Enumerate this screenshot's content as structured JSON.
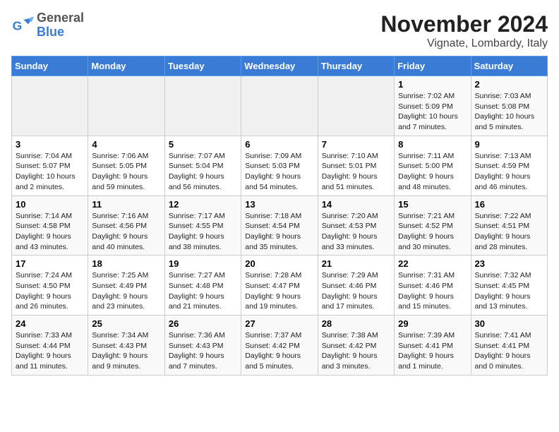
{
  "header": {
    "title": "November 2024",
    "subtitle": "Vignate, Lombardy, Italy",
    "logo_line1": "General",
    "logo_line2": "Blue"
  },
  "weekdays": [
    "Sunday",
    "Monday",
    "Tuesday",
    "Wednesday",
    "Thursday",
    "Friday",
    "Saturday"
  ],
  "weeks": [
    [
      {
        "day": "",
        "info": ""
      },
      {
        "day": "",
        "info": ""
      },
      {
        "day": "",
        "info": ""
      },
      {
        "day": "",
        "info": ""
      },
      {
        "day": "",
        "info": ""
      },
      {
        "day": "1",
        "info": "Sunrise: 7:02 AM\nSunset: 5:09 PM\nDaylight: 10 hours and 7 minutes."
      },
      {
        "day": "2",
        "info": "Sunrise: 7:03 AM\nSunset: 5:08 PM\nDaylight: 10 hours and 5 minutes."
      }
    ],
    [
      {
        "day": "3",
        "info": "Sunrise: 7:04 AM\nSunset: 5:07 PM\nDaylight: 10 hours and 2 minutes."
      },
      {
        "day": "4",
        "info": "Sunrise: 7:06 AM\nSunset: 5:05 PM\nDaylight: 9 hours and 59 minutes."
      },
      {
        "day": "5",
        "info": "Sunrise: 7:07 AM\nSunset: 5:04 PM\nDaylight: 9 hours and 56 minutes."
      },
      {
        "day": "6",
        "info": "Sunrise: 7:09 AM\nSunset: 5:03 PM\nDaylight: 9 hours and 54 minutes."
      },
      {
        "day": "7",
        "info": "Sunrise: 7:10 AM\nSunset: 5:01 PM\nDaylight: 9 hours and 51 minutes."
      },
      {
        "day": "8",
        "info": "Sunrise: 7:11 AM\nSunset: 5:00 PM\nDaylight: 9 hours and 48 minutes."
      },
      {
        "day": "9",
        "info": "Sunrise: 7:13 AM\nSunset: 4:59 PM\nDaylight: 9 hours and 46 minutes."
      }
    ],
    [
      {
        "day": "10",
        "info": "Sunrise: 7:14 AM\nSunset: 4:58 PM\nDaylight: 9 hours and 43 minutes."
      },
      {
        "day": "11",
        "info": "Sunrise: 7:16 AM\nSunset: 4:56 PM\nDaylight: 9 hours and 40 minutes."
      },
      {
        "day": "12",
        "info": "Sunrise: 7:17 AM\nSunset: 4:55 PM\nDaylight: 9 hours and 38 minutes."
      },
      {
        "day": "13",
        "info": "Sunrise: 7:18 AM\nSunset: 4:54 PM\nDaylight: 9 hours and 35 minutes."
      },
      {
        "day": "14",
        "info": "Sunrise: 7:20 AM\nSunset: 4:53 PM\nDaylight: 9 hours and 33 minutes."
      },
      {
        "day": "15",
        "info": "Sunrise: 7:21 AM\nSunset: 4:52 PM\nDaylight: 9 hours and 30 minutes."
      },
      {
        "day": "16",
        "info": "Sunrise: 7:22 AM\nSunset: 4:51 PM\nDaylight: 9 hours and 28 minutes."
      }
    ],
    [
      {
        "day": "17",
        "info": "Sunrise: 7:24 AM\nSunset: 4:50 PM\nDaylight: 9 hours and 26 minutes."
      },
      {
        "day": "18",
        "info": "Sunrise: 7:25 AM\nSunset: 4:49 PM\nDaylight: 9 hours and 23 minutes."
      },
      {
        "day": "19",
        "info": "Sunrise: 7:27 AM\nSunset: 4:48 PM\nDaylight: 9 hours and 21 minutes."
      },
      {
        "day": "20",
        "info": "Sunrise: 7:28 AM\nSunset: 4:47 PM\nDaylight: 9 hours and 19 minutes."
      },
      {
        "day": "21",
        "info": "Sunrise: 7:29 AM\nSunset: 4:46 PM\nDaylight: 9 hours and 17 minutes."
      },
      {
        "day": "22",
        "info": "Sunrise: 7:31 AM\nSunset: 4:46 PM\nDaylight: 9 hours and 15 minutes."
      },
      {
        "day": "23",
        "info": "Sunrise: 7:32 AM\nSunset: 4:45 PM\nDaylight: 9 hours and 13 minutes."
      }
    ],
    [
      {
        "day": "24",
        "info": "Sunrise: 7:33 AM\nSunset: 4:44 PM\nDaylight: 9 hours and 11 minutes."
      },
      {
        "day": "25",
        "info": "Sunrise: 7:34 AM\nSunset: 4:43 PM\nDaylight: 9 hours and 9 minutes."
      },
      {
        "day": "26",
        "info": "Sunrise: 7:36 AM\nSunset: 4:43 PM\nDaylight: 9 hours and 7 minutes."
      },
      {
        "day": "27",
        "info": "Sunrise: 7:37 AM\nSunset: 4:42 PM\nDaylight: 9 hours and 5 minutes."
      },
      {
        "day": "28",
        "info": "Sunrise: 7:38 AM\nSunset: 4:42 PM\nDaylight: 9 hours and 3 minutes."
      },
      {
        "day": "29",
        "info": "Sunrise: 7:39 AM\nSunset: 4:41 PM\nDaylight: 9 hours and 1 minute."
      },
      {
        "day": "30",
        "info": "Sunrise: 7:41 AM\nSunset: 4:41 PM\nDaylight: 9 hours and 0 minutes."
      }
    ]
  ]
}
